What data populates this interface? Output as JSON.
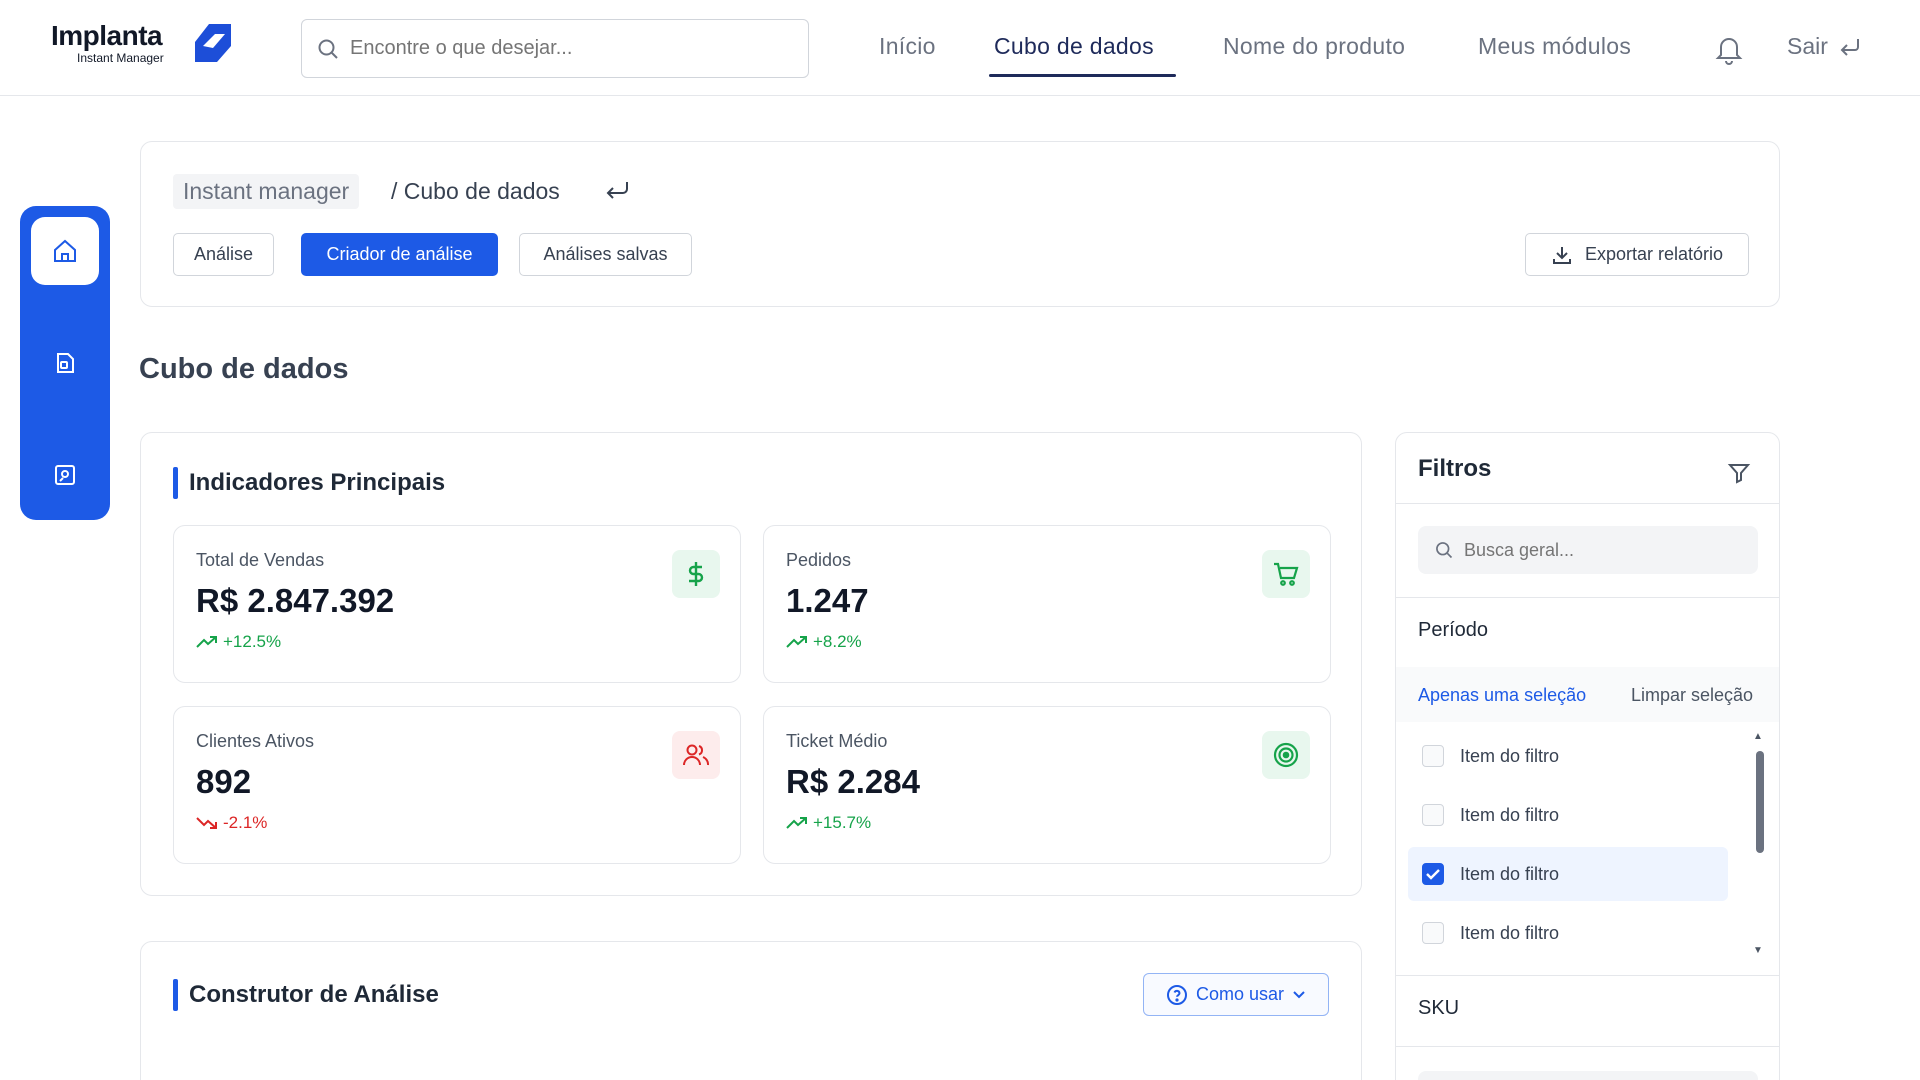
{
  "brand": {
    "name": "Implanta",
    "subtitle": "Instant Manager"
  },
  "search": {
    "placeholder": "Encontre o que desejar..."
  },
  "nav": {
    "items": [
      {
        "label": "Início"
      },
      {
        "label": "Cubo de dados",
        "active": true
      },
      {
        "label": "Nome do produto"
      },
      {
        "label": "Meus módulos"
      }
    ],
    "logout_label": "Sair"
  },
  "breadcrumb": {
    "root": "Instant manager",
    "current": "/ Cubo de dados"
  },
  "tabs": [
    {
      "label": "Análise"
    },
    {
      "label": "Criador de análise",
      "active": true
    },
    {
      "label": "Análises salvas"
    }
  ],
  "export_label": "Exportar relatório",
  "page_title": "Cubo de dados",
  "indicators": {
    "title": "Indicadores Principais",
    "cards": [
      {
        "label": "Total de Vendas",
        "value": "R$ 2.847.392",
        "trend": "+12.5%",
        "direction": "up",
        "icon": "dollar-icon",
        "icon_color": "#16a34a"
      },
      {
        "label": "Pedidos",
        "value": "1.247",
        "trend": "+8.2%",
        "direction": "up",
        "icon": "cart-icon",
        "icon_color": "#16a34a"
      },
      {
        "label": "Clientes Ativos",
        "value": "892",
        "trend": "-2.1%",
        "direction": "down",
        "icon": "users-icon",
        "icon_color": "#dc2626"
      },
      {
        "label": "Ticket Médio",
        "value": "R$ 2.284",
        "trend": "+15.7%",
        "direction": "up",
        "icon": "target-icon",
        "icon_color": "#16a34a"
      }
    ]
  },
  "builder": {
    "title": "Construtor de Análise",
    "howto_label": "Como usar"
  },
  "filters": {
    "title": "Filtros",
    "search_placeholder": "Busca geral...",
    "group_period": "Período",
    "only_one_label": "Apenas uma seleção",
    "clear_label": "Limpar seleção",
    "items": [
      {
        "label": "Item do filtro",
        "checked": false
      },
      {
        "label": "Item do filtro",
        "checked": false
      },
      {
        "label": "Item do filtro",
        "checked": true
      },
      {
        "label": "Item do filtro",
        "checked": false
      }
    ],
    "group_sku": "SKU"
  },
  "colors": {
    "accent": "#1d5ae6",
    "nav_active": "#1e2a5a",
    "up": "#16a34a",
    "down": "#dc2626"
  }
}
